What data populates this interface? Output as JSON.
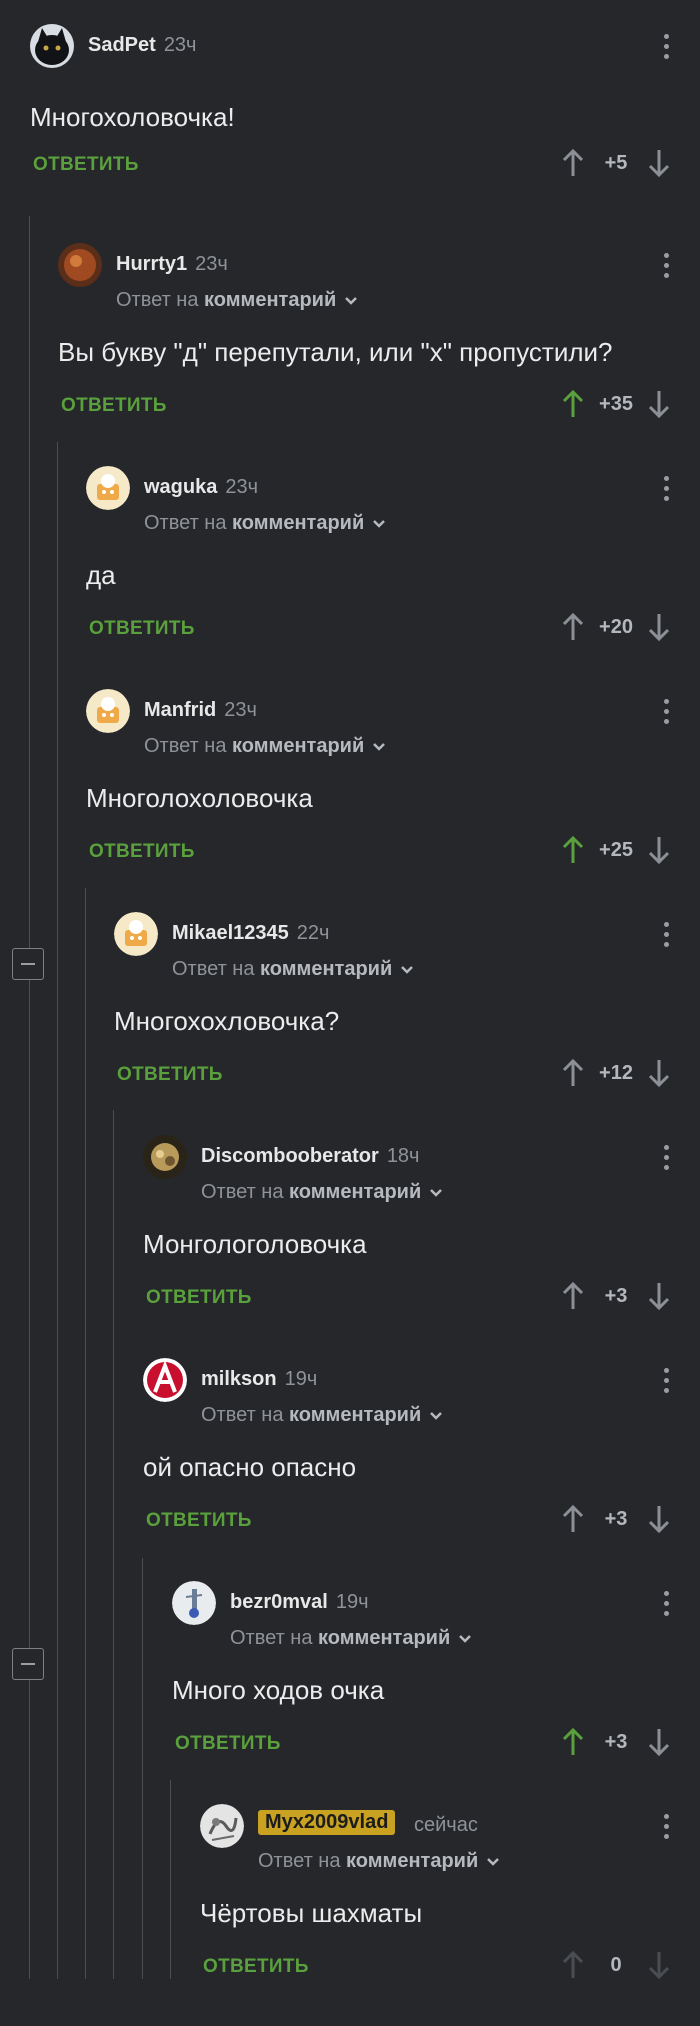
{
  "labels": {
    "reply": "ОТВЕТИТЬ",
    "reply_to_prefix": "Ответ на",
    "reply_to_target": "комментарий"
  },
  "colors": {
    "background": "#25272b",
    "accent_green": "#5aa03c",
    "muted": "#8f9399",
    "badge_gold": "#c9a221"
  },
  "comments": [
    {
      "author": "SadPet",
      "time": "23ч",
      "text": "Многохоловочка!",
      "score": "+5",
      "upvoted": false,
      "is_reply": false,
      "avatar": "black-cat-avatar"
    },
    {
      "author": "Hurrty1",
      "time": "23ч",
      "text": "Вы букву \"д\" перепутали, или \"х\" пропустили?",
      "score": "+35",
      "upvoted": true,
      "is_reply": true,
      "avatar": "brown-avatar"
    },
    {
      "author": "waguka",
      "time": "23ч",
      "text": "да",
      "score": "+20",
      "upvoted": false,
      "is_reply": true,
      "avatar": "default-avatar"
    },
    {
      "author": "Manfrid",
      "time": "23ч",
      "text": "Многолохоловочка",
      "score": "+25",
      "upvoted": true,
      "is_reply": true,
      "avatar": "default-avatar"
    },
    {
      "author": "Mikael12345",
      "time": "22ч",
      "text": "Многохохловочка?",
      "score": "+12",
      "upvoted": false,
      "is_reply": true,
      "avatar": "default-avatar"
    },
    {
      "author": "Discombooberator",
      "time": "18ч",
      "text": "Монгологоловочка",
      "score": "+3",
      "upvoted": false,
      "is_reply": true,
      "avatar": "photo-avatar"
    },
    {
      "author": "milkson",
      "time": "19ч",
      "text": "ой опасно опасно",
      "score": "+3",
      "upvoted": false,
      "is_reply": true,
      "avatar": "anarchy-avatar"
    },
    {
      "author": "bezr0mval",
      "time": "19ч",
      "text": "Много ходов очка",
      "score": "+3",
      "upvoted": true,
      "is_reply": true,
      "avatar": "figure-avatar"
    },
    {
      "author": "Myx2009vlad",
      "time": "сейчас",
      "text": "Чёртовы шахматы",
      "score": "0",
      "upvoted": false,
      "is_reply": true,
      "avatar": "sketch-avatar",
      "highlight": true
    }
  ]
}
